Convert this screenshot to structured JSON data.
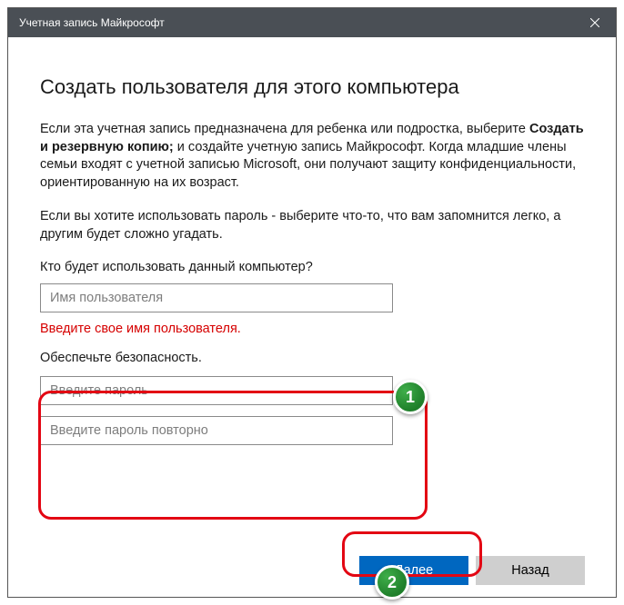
{
  "titlebar": {
    "title": "Учетная запись Майкрософт"
  },
  "heading": "Создать пользователя для этого компьютера",
  "paragraph1": {
    "pre": "Если эта учетная запись предназначена для ребенка или подростка, выберите ",
    "bold": "Создать и резервную копию;",
    "post": " и создайте учетную запись Майкрософт. Когда младшие члены семьи входят с учетной записью Microsoft, они получают защиту конфиденциальности, ориентированную на их возраст."
  },
  "paragraph2": "Если вы хотите использовать пароль - выберите что-то, что вам запомнится легко, а другим будет сложно угадать.",
  "username": {
    "label": "Кто будет использовать данный компьютер?",
    "placeholder": "Имя пользователя",
    "error": "Введите свое имя пользователя."
  },
  "security": {
    "label": "Обеспечьте безопасность.",
    "password_placeholder": "Введите пароль",
    "confirm_placeholder": "Введите пароль повторно"
  },
  "buttons": {
    "next": "Далее",
    "back": "Назад"
  },
  "annotations": {
    "badge1": "1",
    "badge2": "2"
  }
}
